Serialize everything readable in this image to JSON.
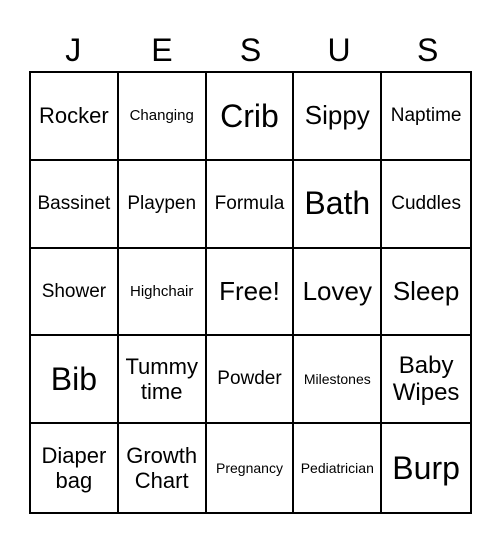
{
  "header": [
    "J",
    "E",
    "S",
    "U",
    "S"
  ],
  "cells": [
    {
      "text": "Rocker",
      "size": "s22"
    },
    {
      "text": "Changing",
      "size": "s15"
    },
    {
      "text": "Crib",
      "size": "s32"
    },
    {
      "text": "Sippy",
      "size": "s26"
    },
    {
      "text": "Naptime",
      "size": "s19"
    },
    {
      "text": "Bassinet",
      "size": "s19"
    },
    {
      "text": "Playpen",
      "size": "s19"
    },
    {
      "text": "Formula",
      "size": "s19"
    },
    {
      "text": "Bath",
      "size": "s32"
    },
    {
      "text": "Cuddles",
      "size": "s19"
    },
    {
      "text": "Shower",
      "size": "s19"
    },
    {
      "text": "Highchair",
      "size": "s15"
    },
    {
      "text": "Free!",
      "size": "s26"
    },
    {
      "text": "Lovey",
      "size": "s26"
    },
    {
      "text": "Sleep",
      "size": "s26"
    },
    {
      "text": "Bib",
      "size": "s32"
    },
    {
      "text": "Tummy time",
      "size": "s22"
    },
    {
      "text": "Powder",
      "size": "s19"
    },
    {
      "text": "Milestones",
      "size": "s14"
    },
    {
      "text": "Baby Wipes",
      "size": "s24"
    },
    {
      "text": "Diaper bag",
      "size": "s22"
    },
    {
      "text": "Growth Chart",
      "size": "s22"
    },
    {
      "text": "Pregnancy",
      "size": "s14"
    },
    {
      "text": "Pediatrician",
      "size": "s14"
    },
    {
      "text": "Burp",
      "size": "s32"
    }
  ]
}
